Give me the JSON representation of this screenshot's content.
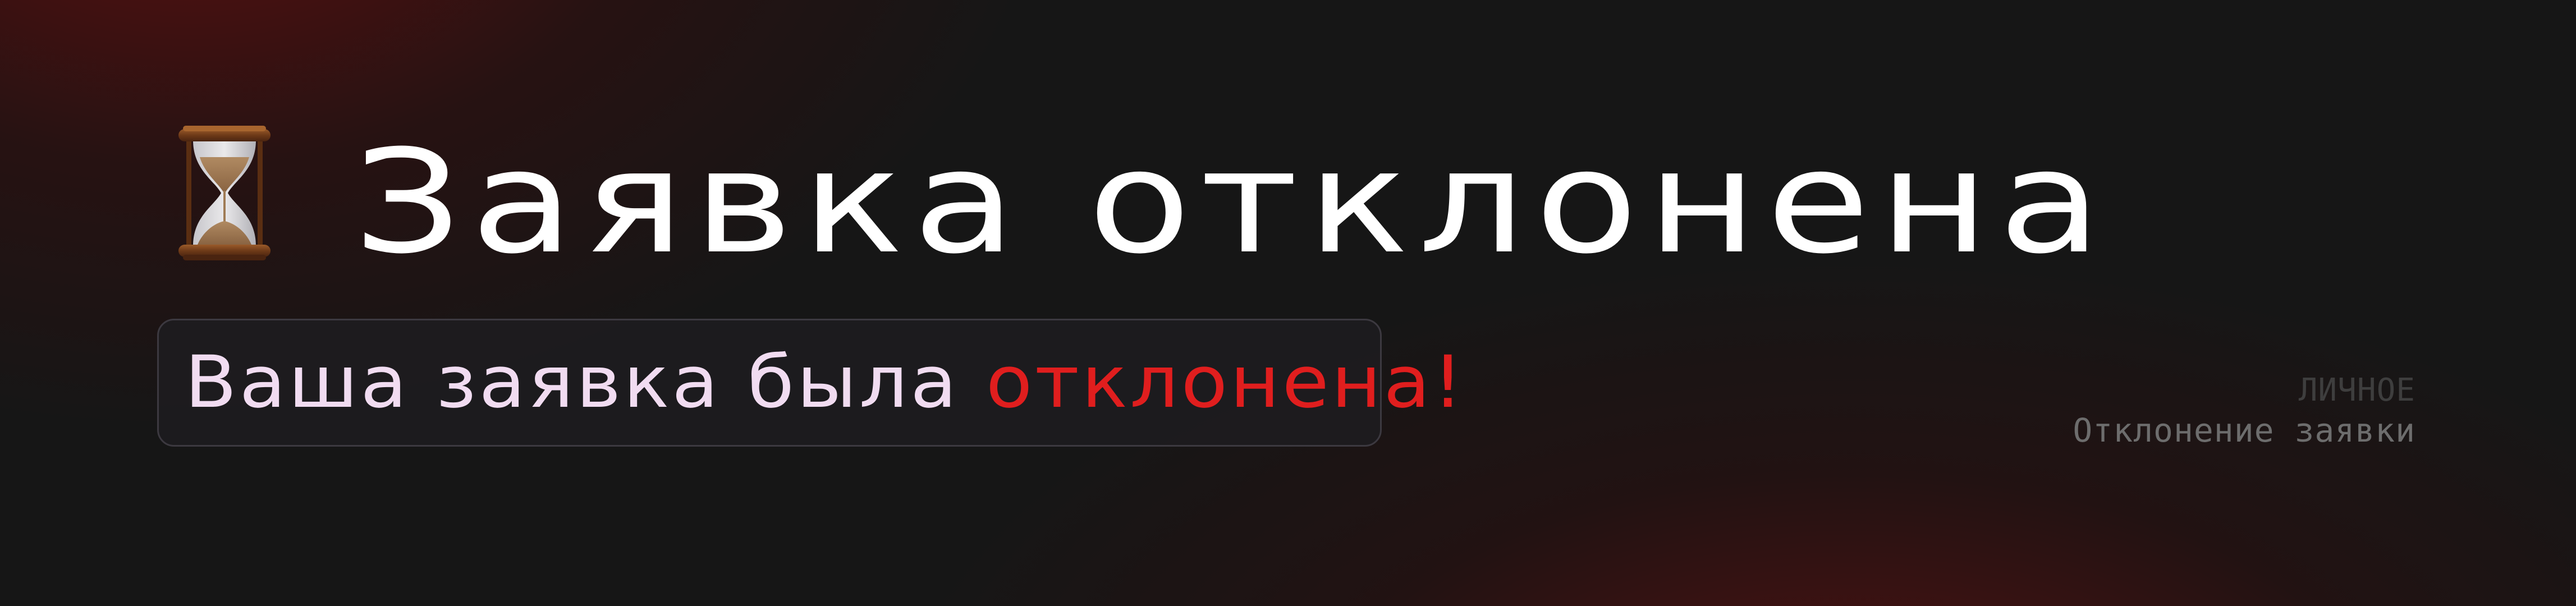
{
  "header": {
    "icon": "hourglass-icon",
    "title": "Заявка отклонена"
  },
  "status": {
    "text_prefix": "Ваша заявка была ",
    "text_highlight": "отклонена!"
  },
  "meta": {
    "category": "ЛИЧНОЕ",
    "subtitle": "Отклонение заявки"
  },
  "colors": {
    "background": "#161616",
    "glow": "#7a0e0e",
    "title": "#ffffff",
    "status_text": "#f1dcf1",
    "status_highlight": "#e01e1e",
    "status_border": "#3c3940",
    "category": "#3e3e3e",
    "subtitle": "#6d6d6d"
  }
}
